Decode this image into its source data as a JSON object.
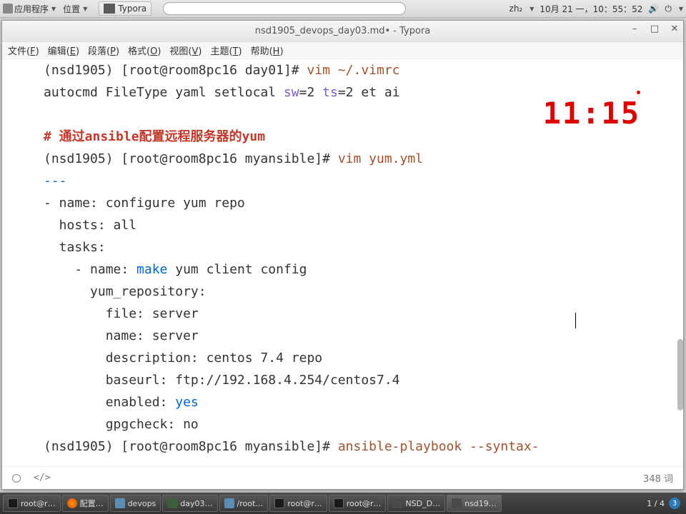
{
  "top": {
    "apps": "应用程序",
    "places": "位置",
    "typora_tab": "Typora",
    "lang": "zh₂",
    "date": "10月 21 一，10：55：52"
  },
  "window": {
    "title": "nsd1905_devops_day03.md• - Typora",
    "menus": [
      "文件(F)",
      "编辑(E)",
      "段落(P)",
      "格式(O)",
      "视图(V)",
      "主题(T)",
      "帮助(H)"
    ]
  },
  "editor": {
    "big_time": "11:15",
    "l1_prompt": "(nsd1905) [root@room8pc16 day01]# ",
    "l1_cmd": "vim ~/.vimrc",
    "l2a": "autocmd FileType yaml setlocal ",
    "l2_sw": "sw",
    "l2_sw_v": "=2 ",
    "l2_ts": "ts",
    "l2_ts_v": "=2 et ai",
    "l4_comment": "# 通过ansible配置远程服务器的yum",
    "l5_prompt": "(nsd1905) [root@room8pc16 myansible]# ",
    "l5_cmd": "vim yum.yml",
    "l6": "---",
    "l7": "- name: configure yum repo",
    "l8": "  hosts: all",
    "l9": "  tasks:",
    "l10a": "    - name: ",
    "l10b": "make",
    "l10c": " yum client config",
    "l11": "      yum_repository:",
    "l12": "        file: server",
    "l13": "        name: server",
    "l14": "        description: centos 7.4 repo",
    "l15_k": "        baseurl: ",
    "l15_v": "ftp://192.168.4.254/centos7.4",
    "l16_k": "        enabled: ",
    "l16_v": "yes",
    "l17_k": "        gpgcheck: ",
    "l17_v": "no",
    "l18_prompt": "(nsd1905) [root@room8pc16 myansible]# ",
    "l18_cmd": "ansible-playbook --syntax-"
  },
  "status": {
    "code": "</>",
    "words": "348 词"
  },
  "taskbar": {
    "t1": "root@r…",
    "t2": "配置…",
    "t3": "devops",
    "t4": "day03…",
    "t5": "/root…",
    "t6": "root@r…",
    "t7": "root@r…",
    "t8": "NSD_D…",
    "t9": "nsd19…",
    "wk_cur": "1",
    "wk_sep": " / ",
    "wk_tot": "4",
    "ws": "3"
  }
}
